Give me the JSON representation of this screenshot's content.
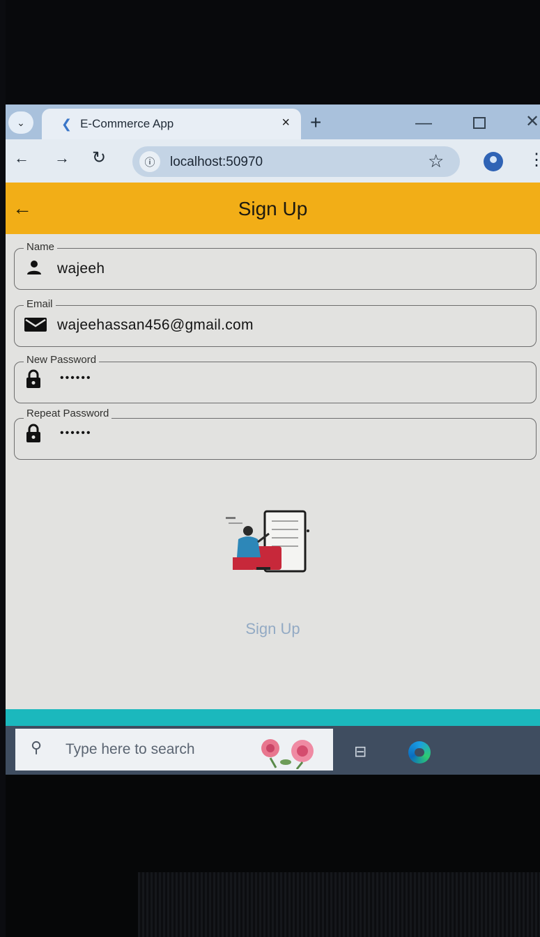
{
  "browser": {
    "tab_title": "E-Commerce App",
    "tab_close": "×",
    "new_tab": "+",
    "url": "localhost:50970",
    "icons": {
      "tab_list": "chevron-down-icon",
      "favicon": "flutter-icon",
      "back": "arrow-left-icon",
      "forward": "arrow-right-icon",
      "reload": "reload-icon",
      "site_info": "info-icon",
      "bookmark": "star-icon",
      "profile": "profile-icon",
      "menu": "kebab-icon"
    }
  },
  "appbar": {
    "title": "Sign Up",
    "color": "#f2ae17"
  },
  "form": {
    "name": {
      "label": "Name",
      "value": "wajeeh",
      "icon": "person-icon"
    },
    "email": {
      "label": "Email",
      "value": "wajeehassan456@gmail.com",
      "icon": "mail-icon"
    },
    "new_password": {
      "label": "New Password",
      "value": "••••••",
      "icon": "lock-icon"
    },
    "repeat_password": {
      "label": "Repeat Password",
      "value": "••••••",
      "icon": "lock-icon"
    },
    "submit_label": "Sign Up"
  },
  "taskbar": {
    "search_placeholder": "Type here to search",
    "accent": "#1bb8bd"
  }
}
